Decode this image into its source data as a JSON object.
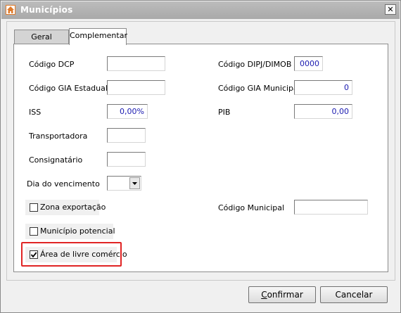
{
  "window": {
    "title": "Municípios",
    "close_glyph": "✕"
  },
  "tabs": [
    {
      "label": "Geral"
    },
    {
      "label": "Complementar"
    }
  ],
  "fields": {
    "codigo_dcp": {
      "label": "Código DCP",
      "value": ""
    },
    "codigo_gia_estadual": {
      "label": "Código GIA Estadual",
      "value": ""
    },
    "iss": {
      "label": "ISS",
      "value": "0,00%"
    },
    "transportadora": {
      "label": "Transportadora",
      "value": ""
    },
    "consignatario": {
      "label": "Consignatário",
      "value": ""
    },
    "dia_vencimento": {
      "label": "Dia do vencimento",
      "value": ""
    },
    "codigo_dipj_dimob": {
      "label": "Código DIPJ/DIMOB",
      "value": "0000"
    },
    "codigo_gia_municipal": {
      "label": "Código GIA Municipal",
      "value": "0"
    },
    "pib": {
      "label": "PIB",
      "value": "0,00"
    },
    "codigo_municipal": {
      "label": "Código Municipal",
      "value": ""
    }
  },
  "checkboxes": {
    "zona_exportacao": {
      "label": "Zona exportação",
      "checked": false
    },
    "municipio_potencial": {
      "label": "Município potencial",
      "checked": false
    },
    "area_livre_comercio": {
      "label": "Área de livre comércio",
      "checked": true
    }
  },
  "buttons": {
    "confirmar": {
      "mnemonic": "C",
      "rest": "onfirmar"
    },
    "cancelar": {
      "mnemonic": "",
      "rest": "Cancelar"
    }
  },
  "colors": {
    "highlight": "#e02424",
    "value_text": "#1a1ab0"
  },
  "icons": {
    "app": "home-icon",
    "dropdown": "chevron-down-icon",
    "check": "checkmark-icon"
  }
}
